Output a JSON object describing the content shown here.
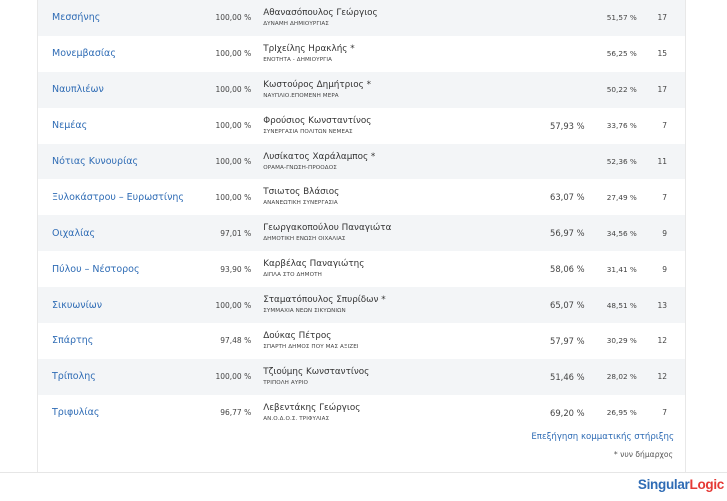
{
  "rows": [
    {
      "municipality": "Μεσσήνης",
      "counted": "100,00 %",
      "candidate": "Αθανασόπουλος Γεώργιος",
      "party": "ΔΥΝΑΜΗ ΔΗΜΙΟΥΡΓΙΑΣ",
      "first_round": "",
      "second_round": "51,57 %",
      "seats": "17"
    },
    {
      "municipality": "Μονεμβασίας",
      "counted": "100,00 %",
      "candidate": "ΤρIχείλης Ηρακλής *",
      "party": "ΕΝΟΤΗΤΑ - ΔΗΜΙΟΥΡΓΙΑ",
      "first_round": "",
      "second_round": "56,25 %",
      "seats": "15"
    },
    {
      "municipality": "Ναυπλιέων",
      "counted": "100,00 %",
      "candidate": "Κωστούρος Δημήτριος *",
      "party": "ΝΑΥΠΛΙΟ.ΕΠΟΜΕΝΗ ΜΕΡΑ",
      "first_round": "",
      "second_round": "50,22 %",
      "seats": "17"
    },
    {
      "municipality": "Νεμέας",
      "counted": "100,00 %",
      "candidate": "Φρούσιος Κωνσταντίνος",
      "party": "ΣΥΝΕΡΓΑΣΙΑ ΠΟΛΙΤΩΝ ΝΕΜΕΑΣ",
      "first_round": "57,93 %",
      "second_round": "33,76 %",
      "seats": "7"
    },
    {
      "municipality": "Νότιας Κυνουρίας",
      "counted": "100,00 %",
      "candidate": "Λυσίκατος Χαράλαμπος *",
      "party": "ΟΡΑΜΑ-ΓΝΩΣΗ-ΠΡΟΟΔΟΣ",
      "first_round": "",
      "second_round": "52,36 %",
      "seats": "11"
    },
    {
      "municipality": "Ξυλοκάστρου – Ευρωστίνης",
      "counted": "100,00 %",
      "candidate": "Τσιωτος Βλάσιος",
      "party": "ΑΝΑΝΕΩΤΙΚΗ ΣΥΝΕΡΓΑΣΙΑ",
      "first_round": "63,07 %",
      "second_round": "27,49 %",
      "seats": "7"
    },
    {
      "municipality": "Οιχαλίας",
      "counted": "97,01 %",
      "candidate": "Γεωργακοπούλου Παναγιώτα",
      "party": "ΔΗΜΟΤΙΚΗ ΕΝΩΣΗ ΟΙΧΑΛΙΑΣ",
      "first_round": "56,97 %",
      "second_round": "34,56 %",
      "seats": "9"
    },
    {
      "municipality": "Πύλου – Νέστορος",
      "counted": "93,90 %",
      "candidate": "Καρβέλας Παναγιώτης",
      "party": "ΔΙΠΛΑ ΣΤΟ ΔΗΜΟΤΗ",
      "first_round": "58,06 %",
      "second_round": "31,41 %",
      "seats": "9"
    },
    {
      "municipality": "Σικυωνίων",
      "counted": "100,00 %",
      "candidate": "Σταματόπουλος Σπυρίδων *",
      "party": "ΣΥΜΜΑΧΙΑ ΝΕΩΝ ΣΙΚΥΩΝΙΩΝ",
      "first_round": "65,07 %",
      "second_round": "48,51 %",
      "seats": "13"
    },
    {
      "municipality": "Σπάρτης",
      "counted": "97,48 %",
      "candidate": "Δούκας Πέτρος",
      "party": "ΣΠΑΡΤΗ ΔΗΜΟΣ ΠΟΥ ΜΑΣ ΑΞΙΖΕΙ",
      "first_round": "57,97 %",
      "second_round": "30,29 %",
      "seats": "12"
    },
    {
      "municipality": "Τρίπολης",
      "counted": "100,00 %",
      "candidate": "Τζιούμης Κωνσταντίνος",
      "party": "ΤΡΙΠΟΛΗ ΑΥΡΙΟ",
      "first_round": "51,46 %",
      "second_round": "28,02 %",
      "seats": "12"
    },
    {
      "municipality": "Τριφυλίας",
      "counted": "96,77 %",
      "candidate": "Λεβεντάκης Γεώργιος",
      "party": "ΑΝ.Ο.Δ.Ο.Σ. ΤΡΙΦΥΛΙΑΣ",
      "first_round": "69,20 %",
      "second_round": "26,95 %",
      "seats": "7"
    }
  ],
  "support_link": "Επεξήγηση κομματικής στήριξης",
  "footnote": "* νυν δήμαρχος",
  "logo": {
    "part1": "Singular",
    "part2": "Logic"
  },
  "colors": {
    "link": "#2f6cb5",
    "row_alt": "#f3f5f7",
    "logo_accent": "#e53935"
  }
}
